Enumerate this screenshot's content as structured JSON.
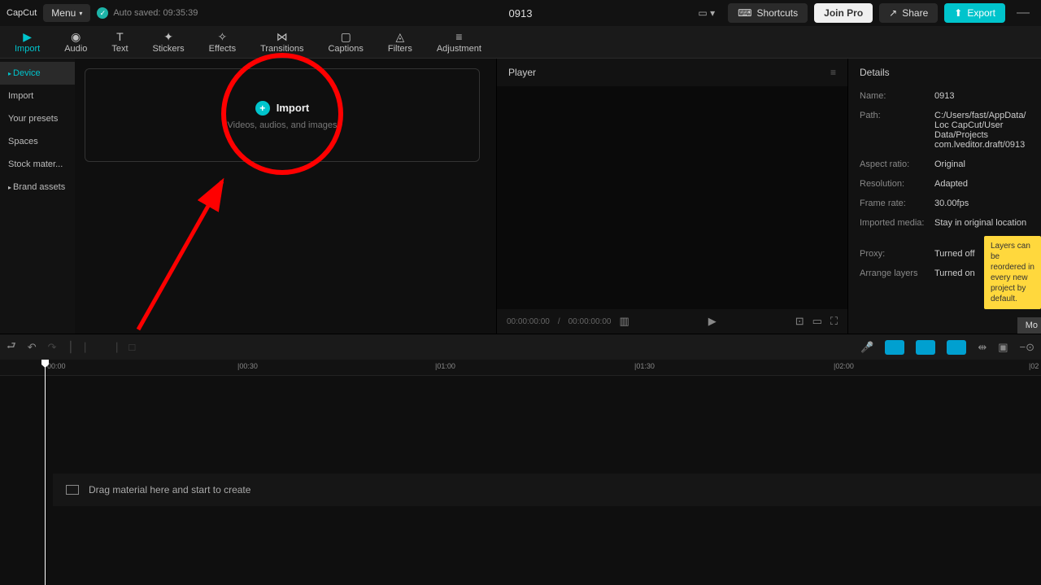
{
  "app_name": "CapCut",
  "menu_label": "Menu",
  "autosave": "Auto saved: 09:35:39",
  "project_title": "0913",
  "topbar": {
    "shortcuts": "Shortcuts",
    "joinpro": "Join Pro",
    "share": "Share",
    "export": "Export"
  },
  "tooltabs": [
    {
      "label": "Import",
      "active": true
    },
    {
      "label": "Audio"
    },
    {
      "label": "Text"
    },
    {
      "label": "Stickers"
    },
    {
      "label": "Effects"
    },
    {
      "label": "Transitions"
    },
    {
      "label": "Captions"
    },
    {
      "label": "Filters"
    },
    {
      "label": "Adjustment"
    }
  ],
  "sidebar": {
    "items": [
      {
        "label": "Device",
        "active": true,
        "caret": true
      },
      {
        "label": "Import"
      },
      {
        "label": "Your presets"
      },
      {
        "label": "Spaces"
      },
      {
        "label": "Stock mater..."
      },
      {
        "label": "Brand assets",
        "caret": true
      }
    ]
  },
  "import_box": {
    "title": "Import",
    "subtitle": "Videos, audios, and images"
  },
  "player": {
    "title": "Player",
    "time_current": "00:00:00:00",
    "time_total": "00:00:00:00"
  },
  "details": {
    "title": "Details",
    "rows": [
      {
        "label": "Name:",
        "value": "0913"
      },
      {
        "label": "Path:",
        "value": "C:/Users/fast/AppData/Loc CapCut/User Data/Projects com.lveditor.draft/0913"
      },
      {
        "label": "Aspect ratio:",
        "value": "Original"
      },
      {
        "label": "Resolution:",
        "value": "Adapted"
      },
      {
        "label": "Frame rate:",
        "value": "30.00fps"
      },
      {
        "label": "Imported media:",
        "value": "Stay in original location"
      },
      {
        "label": "Proxy:",
        "value": "Turned off"
      },
      {
        "label": "Arrange layers",
        "value": "Turned on"
      }
    ],
    "tooltip": "Layers can be reordered in every new project by default.",
    "modify": "Mo"
  },
  "timeline": {
    "ticks": [
      "00:00",
      "|00:30",
      "|01:00",
      "|01:30",
      "|02:00",
      "|02"
    ],
    "drop_hint": "Drag material here and start to create"
  }
}
